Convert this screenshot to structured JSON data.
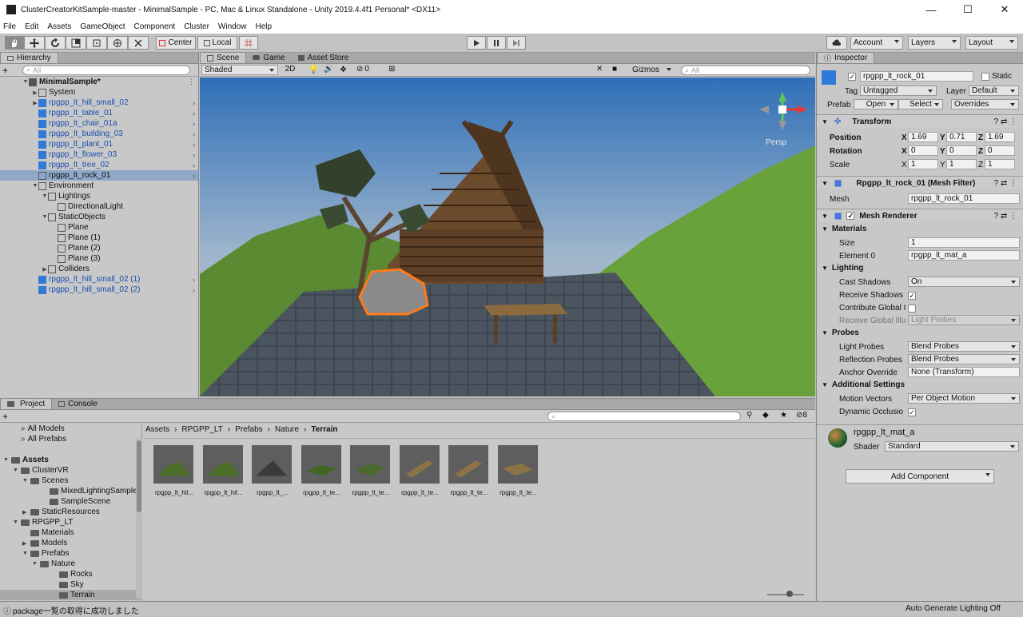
{
  "window": {
    "title": "ClusterCreatorKitSample-master - MinimalSample - PC, Mac & Linux Standalone - Unity 2019.4.4f1 Personal* <DX11>",
    "minimize": "—",
    "maximize": "☐",
    "close": "✕"
  },
  "menu": [
    "File",
    "Edit",
    "Assets",
    "GameObject",
    "Component",
    "Cluster",
    "Window",
    "Help"
  ],
  "toolbar": {
    "center": "Center",
    "local": "Local",
    "account": "Account",
    "layers": "Layers",
    "layout": "Layout"
  },
  "hierarchy": {
    "tab": "Hierarchy",
    "search_placeholder": "All",
    "add": "+",
    "rows": [
      {
        "label": "MinimalSample*",
        "bold": true
      },
      {
        "label": "System"
      },
      {
        "label": "rpgpp_lt_hill_small_02",
        "blue": true
      },
      {
        "label": "rpgpp_lt_table_01",
        "blue": true
      },
      {
        "label": "rpgpp_lt_chair_01a",
        "blue": true
      },
      {
        "label": "rpgpp_lt_building_03",
        "blue": true
      },
      {
        "label": "rpgpp_lt_plant_01",
        "blue": true
      },
      {
        "label": "rpgpp_lt_flower_03",
        "blue": true
      },
      {
        "label": "rpgpp_lt_tree_02",
        "blue": true
      },
      {
        "label": "rpgpp_lt_rock_01",
        "selected": true
      },
      {
        "label": "Environment"
      },
      {
        "label": "Lightings"
      },
      {
        "label": "DirectionalLight"
      },
      {
        "label": "StaticObjects"
      },
      {
        "label": "Plane"
      },
      {
        "label": "Plane (1)"
      },
      {
        "label": "Plane (2)"
      },
      {
        "label": "Plane (3)"
      },
      {
        "label": "Colliders"
      },
      {
        "label": "rpgpp_lt_hill_small_02 (1)",
        "blue": true
      },
      {
        "label": "rpgpp_lt_hill_small_02 (2)",
        "blue": true
      }
    ]
  },
  "scene": {
    "tabs": [
      "Scene",
      "Game",
      "Asset Store"
    ],
    "shading": "Shaded",
    "mode2d": "2D",
    "hidden_count": "0",
    "gizmos": "Gizmos",
    "search_placeholder": "All",
    "persp": "Persp"
  },
  "inspector": {
    "tab": "Inspector",
    "object_name": "rpgpp_lt_rock_01",
    "static": "Static",
    "tag_label": "Tag",
    "tag": "Untagged",
    "layer_label": "Layer",
    "layer": "Default",
    "prefab_label": "Prefab",
    "open": "Open",
    "select": "Select",
    "overrides": "Overrides",
    "transform": {
      "title": "Transform",
      "position": "Position",
      "rotation": "Rotation",
      "scale": "Scale",
      "pos": {
        "x": "1.69",
        "y": "0.71",
        "z": "1.69"
      },
      "rot": {
        "x": "0",
        "y": "0",
        "z": "0"
      },
      "scl": {
        "x": "1",
        "y": "1",
        "z": "1"
      }
    },
    "mesh_filter": {
      "title": "Rpgpp_lt_rock_01 (Mesh Filter)",
      "mesh_label": "Mesh",
      "mesh": "rpgpp_lt_rock_01"
    },
    "mesh_renderer": {
      "title": "Mesh Renderer",
      "materials": "Materials",
      "size_label": "Size",
      "size": "1",
      "element_label": "Element 0",
      "element": "rpgpp_lt_mat_a",
      "lighting": "Lighting",
      "cast_label": "Cast Shadows",
      "cast": "On",
      "receive_label": "Receive Shadows",
      "contrib_label": "Contribute Global I",
      "receive_gi_label": "Receive Global Illu",
      "receive_gi": "Light Probes",
      "probes": "Probes",
      "light_probes_label": "Light Probes",
      "light_probes": "Blend Probes",
      "refl_label": "Reflection Probes",
      "refl": "Blend Probes",
      "anchor_label": "Anchor Override",
      "anchor": "None (Transform)",
      "additional": "Additional Settings",
      "motion_label": "Motion Vectors",
      "motion": "Per Object Motion",
      "dyn_label": "Dynamic Occlusio"
    },
    "material": {
      "name": "rpgpp_lt_mat_a",
      "shader_label": "Shader",
      "shader": "Standard"
    },
    "add_component": "Add Component"
  },
  "project": {
    "tabs": [
      "Project",
      "Console"
    ],
    "add": "+",
    "hidden_count": "8",
    "tree": [
      {
        "label": "All Models",
        "indent": 1,
        "kind": "search"
      },
      {
        "label": "All Prefabs",
        "indent": 1,
        "kind": "search"
      },
      {
        "label": "",
        "indent": 0,
        "kind": "blank"
      },
      {
        "label": "Assets",
        "indent": 0,
        "kind": "folder",
        "bold": true,
        "open": true
      },
      {
        "label": "ClusterVR",
        "indent": 1,
        "kind": "folder",
        "open": true
      },
      {
        "label": "Scenes",
        "indent": 2,
        "kind": "folder",
        "open": true
      },
      {
        "label": "MixedLightingSample",
        "indent": 4,
        "kind": "folder"
      },
      {
        "label": "SampleScene",
        "indent": 4,
        "kind": "folder"
      },
      {
        "label": "StaticResources",
        "indent": 2,
        "kind": "folder",
        "closed": true
      },
      {
        "label": "RPGPP_LT",
        "indent": 1,
        "kind": "folder",
        "open": true
      },
      {
        "label": "Materials",
        "indent": 2,
        "kind": "folder"
      },
      {
        "label": "Models",
        "indent": 2,
        "kind": "folder",
        "closed": true
      },
      {
        "label": "Prefabs",
        "indent": 2,
        "kind": "folder",
        "open": true
      },
      {
        "label": "Nature",
        "indent": 3,
        "kind": "folder",
        "open": true
      },
      {
        "label": "Rocks",
        "indent": 5,
        "kind": "folder"
      },
      {
        "label": "Sky",
        "indent": 5,
        "kind": "folder"
      },
      {
        "label": "Terrain",
        "indent": 5,
        "kind": "folder",
        "selected": true
      }
    ],
    "breadcrumb": [
      "Assets",
      "RPGPP_LT",
      "Prefabs",
      "Nature",
      "Terrain"
    ],
    "assets": [
      {
        "label": "rpgpp_lt_hil...",
        "type": "hill"
      },
      {
        "label": "rpgpp_lt_hil...",
        "type": "hill"
      },
      {
        "label": "rpgpp_lt_...",
        "type": "darkhill"
      },
      {
        "label": "rpgpp_lt_te...",
        "type": "flatgreen"
      },
      {
        "label": "rpgpp_lt_te...",
        "type": "flatgreen2"
      },
      {
        "label": "rpgpp_lt_te...",
        "type": "plank"
      },
      {
        "label": "rpgpp_lt_te...",
        "type": "plank"
      },
      {
        "label": "rpgpp_lt_te...",
        "type": "plank2"
      }
    ]
  },
  "status": {
    "message": "package一覧の取得に成功しました",
    "lighting": "Auto Generate Lighting Off"
  }
}
